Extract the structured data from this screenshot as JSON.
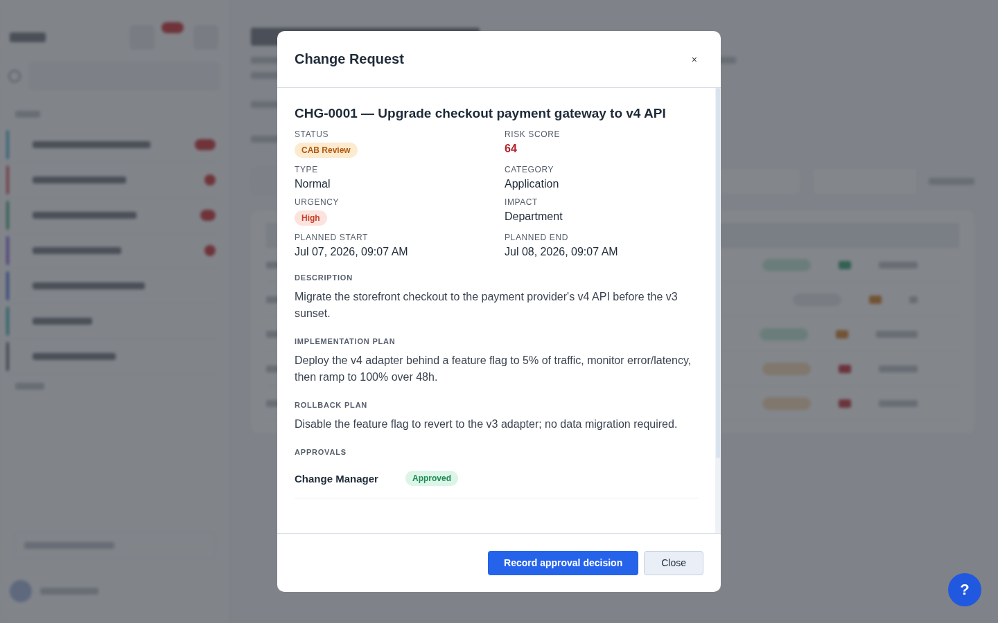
{
  "dialog": {
    "title": "Change Request",
    "close_icon": "×",
    "heading": "CHG-0001 — Upgrade checkout payment gateway to v4 API",
    "fields": [
      {
        "label": "STATUS",
        "value": "CAB Review",
        "kind": "pill-review"
      },
      {
        "label": "RISK SCORE",
        "value": "64",
        "kind": "score-high"
      },
      {
        "label": "TYPE",
        "value": "Normal",
        "kind": "text"
      },
      {
        "label": "CATEGORY",
        "value": "Application",
        "kind": "text"
      },
      {
        "label": "URGENCY",
        "value": "High",
        "kind": "pill-high"
      },
      {
        "label": "IMPACT",
        "value": "Department",
        "kind": "text"
      },
      {
        "label": "PLANNED START",
        "value": "Jul 07, 2026, 09:07 AM",
        "kind": "text"
      },
      {
        "label": "PLANNED END",
        "value": "Jul 08, 2026, 09:07 AM",
        "kind": "text"
      }
    ],
    "sections": [
      {
        "label": "DESCRIPTION",
        "text": "Migrate the storefront checkout to the payment provider's v4 API before the v3 sunset."
      },
      {
        "label": "IMPLEMENTATION PLAN",
        "text": "Deploy the v4 adapter behind a feature flag to 5% of traffic, monitor error/latency, then ramp to 100% over 48h."
      },
      {
        "label": "ROLLBACK PLAN",
        "text": "Disable the feature flag to revert to the v3 adapter; no data migration required."
      }
    ],
    "approvals_label": "APPROVALS",
    "approvals": [
      {
        "role": "Change Manager",
        "status": "Approved"
      }
    ],
    "primary_button": "Record approval decision",
    "secondary_button": "Close"
  },
  "help_button": "?"
}
